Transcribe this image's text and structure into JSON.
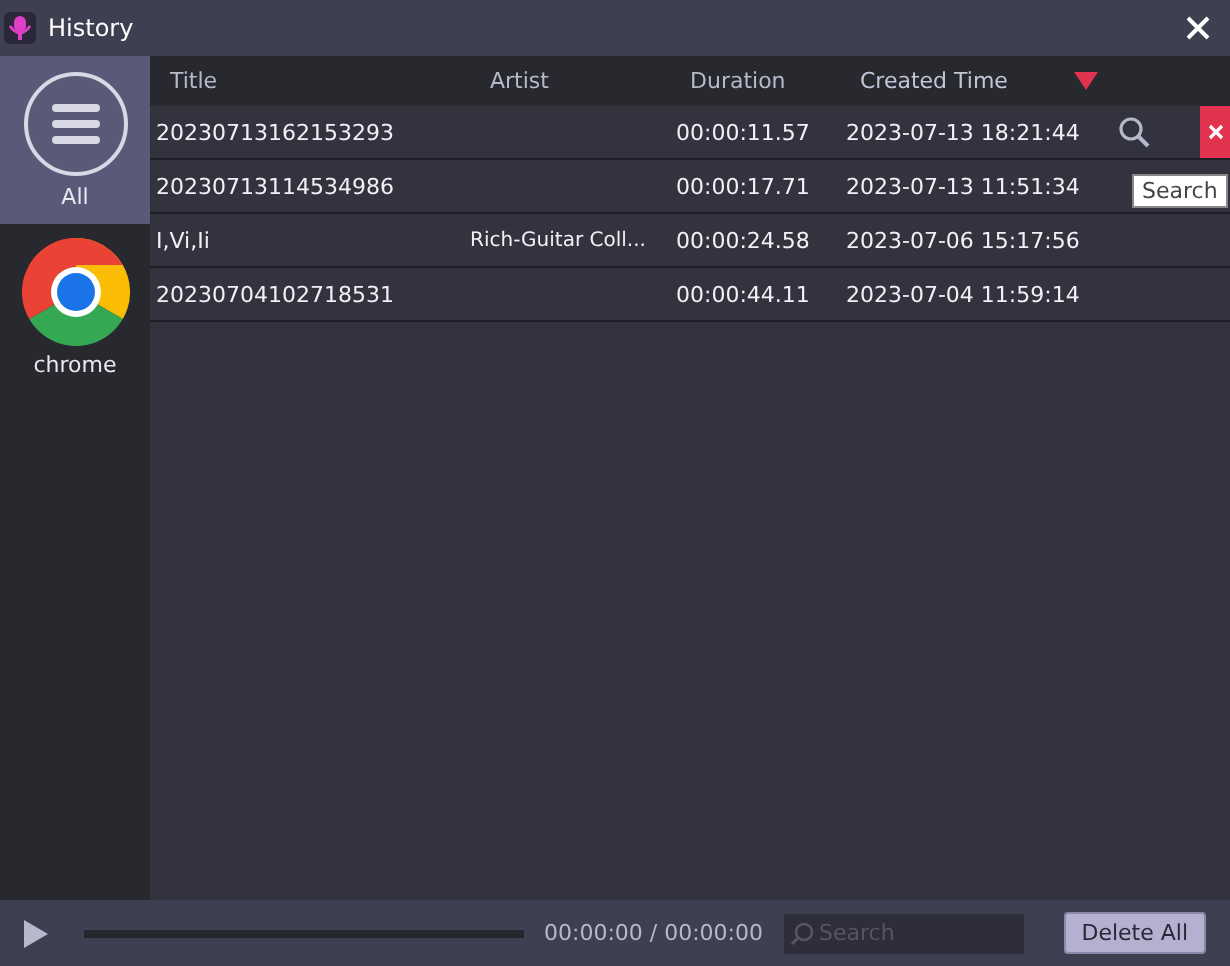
{
  "window": {
    "title": "History"
  },
  "sidebar": {
    "items": [
      {
        "label": "All",
        "kind": "all",
        "selected": true
      },
      {
        "label": "chrome",
        "kind": "chrome",
        "selected": false
      }
    ]
  },
  "table": {
    "columns": [
      {
        "label": "Title",
        "sorted": false
      },
      {
        "label": "Artist",
        "sorted": false
      },
      {
        "label": "Duration",
        "sorted": false
      },
      {
        "label": "Created Time",
        "sorted": true
      }
    ],
    "rows": [
      {
        "cells": [
          "20230713162153293",
          "",
          "00:00:11.57",
          "2023-07-13 18:21:44"
        ],
        "hovered": true
      },
      {
        "cells": [
          "20230713114534986",
          "",
          "00:00:17.71",
          "2023-07-13 11:51:34"
        ],
        "hovered": false
      },
      {
        "cells": [
          "I,Vi,Ii",
          "Rich-Guitar Coll...",
          "00:00:24.58",
          "2023-07-06 15:17:56"
        ],
        "hovered": false
      },
      {
        "cells": [
          "20230704102718531",
          "",
          "00:00:44.11",
          "2023-07-04 11:59:14"
        ],
        "hovered": false
      }
    ]
  },
  "tooltip": {
    "text": "Search"
  },
  "player": {
    "time": "00:00:00 / 00:00:00",
    "search": {
      "placeholder": "Search"
    },
    "button": "Delete All"
  }
}
